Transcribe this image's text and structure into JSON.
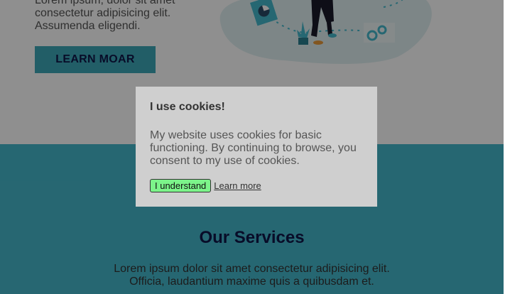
{
  "hero": {
    "text_lines": [
      "Lorem ipsum, dolor sit amet",
      "consectetur adipisicing elit.",
      "Assumenda eligendi."
    ],
    "cta_label": "LEARN MOAR"
  },
  "services": {
    "title": "Our Services",
    "text_lines": [
      "Lorem ipsum dolor sit amet consectetur adipisicing elit.",
      "Officia, laudantium maxime quis a quibusdam et."
    ]
  },
  "cookie_dialog": {
    "title": "I use cookies!",
    "body": "My website uses cookies for basic functioning. By continuing to browse, you consent to my use of cookies.",
    "accept_label": "I understand",
    "learn_more_label": "Learn more"
  },
  "colors": {
    "accent_teal": "#45b8cc",
    "button_teal": "#3da8b8",
    "navy": "#0f1648",
    "accept_green": "#7cf48a"
  },
  "icons": [
    "pie-chart-icon",
    "gear-icon",
    "plant-icon"
  ]
}
